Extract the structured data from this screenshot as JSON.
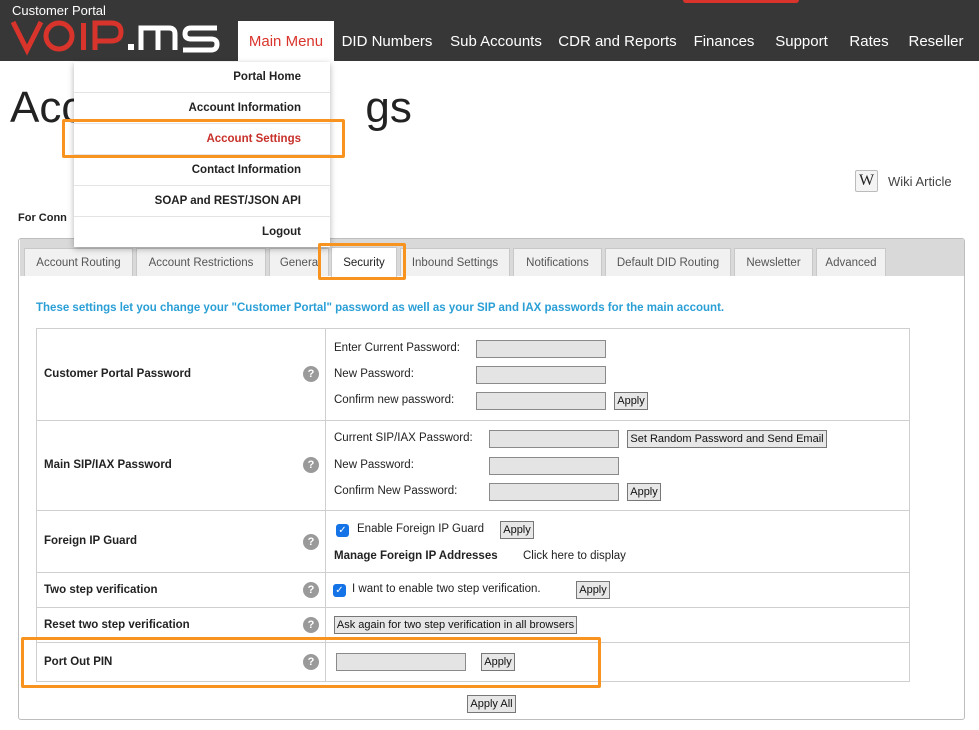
{
  "header": {
    "portal_label": "Customer Portal",
    "logo_text": "VoIP.ms",
    "nav": [
      "Main Menu",
      "DID Numbers",
      "Sub Accounts",
      "CDR and Reports",
      "Finances",
      "Support",
      "Rates",
      "Reseller"
    ],
    "active_nav": "Main Menu"
  },
  "page": {
    "title_visible": "Acc",
    "title_tail": "gs",
    "for_connect": "For Conn",
    "wiki_icon": "W",
    "wiki_label": "Wiki Article"
  },
  "dropdown": {
    "items": [
      "Portal Home",
      "Account Information",
      "Account Settings",
      "Contact Information",
      "SOAP and REST/JSON API",
      "Logout"
    ],
    "current": "Account Settings"
  },
  "tabs": {
    "items": [
      "Account Routing",
      "Account Restrictions",
      "Genera",
      "Security",
      "Inbound Settings",
      "Notifications",
      "Default DID Routing",
      "Newsletter",
      "Advanced"
    ],
    "active": "Security"
  },
  "security": {
    "intro": "These settings let you change your \"Customer Portal\" password as well as your SIP and IAX passwords for the main account.",
    "help_glyph": "?",
    "portal_password": {
      "label": "Customer Portal Password",
      "current": "Enter Current Password:",
      "new": "New Password:",
      "confirm": "Confirm new password:",
      "apply": "Apply"
    },
    "sip_password": {
      "label": "Main SIP/IAX Password",
      "current": "Current SIP/IAX Password:",
      "random_button": "Set Random Password and Send Email",
      "new": "New Password:",
      "confirm": "Confirm New Password:",
      "apply": "Apply"
    },
    "foreign_ip": {
      "label": "Foreign IP Guard",
      "checkbox_label": "Enable Foreign IP Guard",
      "checked": true,
      "apply": "Apply",
      "manage_label": "Manage Foreign IP Addresses",
      "manage_link": "Click here to display"
    },
    "two_step": {
      "label": "Two step verification",
      "checkbox_label": "I want to enable two step verification.",
      "checked": true,
      "apply": "Apply"
    },
    "reset_two_step": {
      "label": "Reset two step verification",
      "button": "Ask again for two step verification in all browsers"
    },
    "port_out": {
      "label": "Port Out PIN",
      "apply": "Apply"
    },
    "apply_all": "Apply All"
  },
  "colors": {
    "header_bg": "#373737",
    "brand_red": "#d9342b",
    "intro_blue": "#2a9fd6",
    "highlight_orange": "#f7931e",
    "checkbox_blue": "#1473e6"
  }
}
